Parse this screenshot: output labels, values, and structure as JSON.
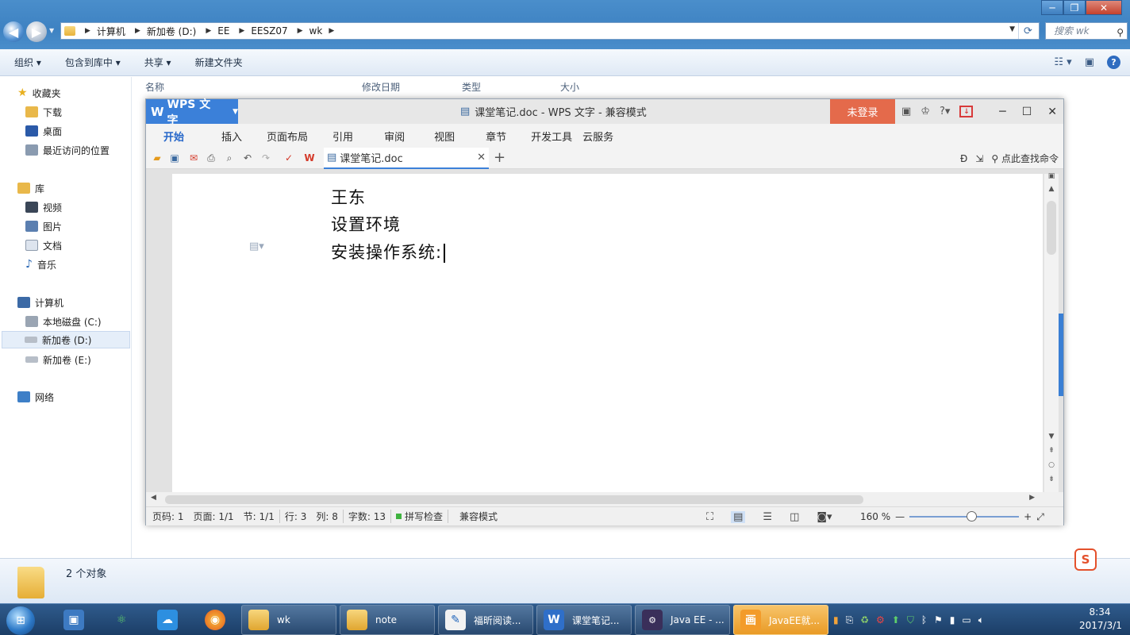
{
  "explorer": {
    "breadcrumb": [
      "计算机",
      "新加卷 (D:)",
      "EE",
      "EESZ07",
      "wk"
    ],
    "search_placeholder": "搜索 wk",
    "toolbar": [
      "组织",
      "包含到库中",
      "共享",
      "新建文件夹"
    ],
    "columns": [
      "名称",
      "修改日期",
      "类型",
      "大小"
    ],
    "nav": {
      "favorites": "收藏夹",
      "downloads": "下载",
      "desktop": "桌面",
      "recent": "最近访问的位置",
      "libraries": "库",
      "videos": "视频",
      "pictures": "图片",
      "documents": "文档",
      "music": "音乐",
      "computer": "计算机",
      "drive_c": "本地磁盘 (C:)",
      "drive_d": "新加卷 (D:)",
      "drive_e": "新加卷 (E:)",
      "network": "网络"
    },
    "status": "2 个对象"
  },
  "wps": {
    "app_name": "WPS 文字",
    "title": "课堂笔记.doc - WPS 文字 - 兼容模式",
    "login": "未登录",
    "menu": [
      "开始",
      "插入",
      "页面布局",
      "引用",
      "审阅",
      "视图",
      "章节",
      "开发工具",
      "云服务"
    ],
    "doc_tab": "课堂笔记.doc",
    "find_cmd": "点此查找命令",
    "document_lines": [
      "王东",
      "设置环境",
      "安装操作系统:"
    ],
    "status": {
      "page_num": "页码: 1",
      "pages": "页面: 1/1",
      "section": "节: 1/1",
      "row": "行: 3",
      "col": "列: 8",
      "words": "字数: 13",
      "spell": "拼写检查",
      "compat": "兼容模式",
      "zoom": "160 %"
    }
  },
  "taskbar": {
    "items": [
      "wk",
      "note",
      "福昕阅读...",
      "课堂笔记...",
      "Java EE - ...",
      "JavaEE就..."
    ],
    "time": "8:34",
    "date": "2017/3/1"
  }
}
